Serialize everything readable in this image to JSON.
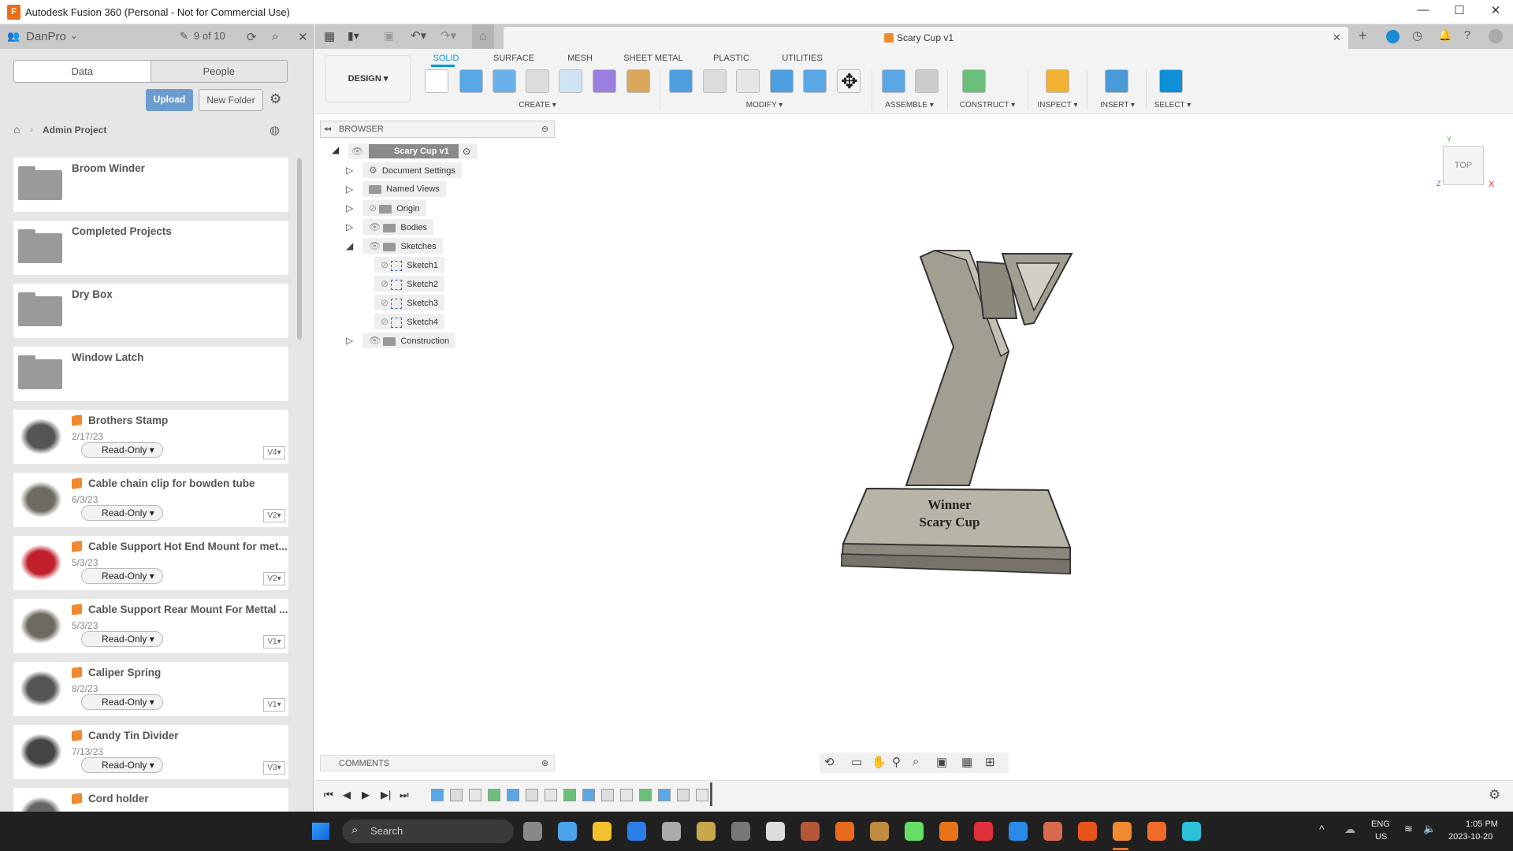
{
  "window": {
    "title": "Autodesk Fusion 360 (Personal - Not for Commercial Use)",
    "logo": "F"
  },
  "data_panel": {
    "team": "DanPro",
    "count": "9 of 10",
    "tabs": [
      "Data",
      "People"
    ],
    "upload": "Upload",
    "new_folder": "New Folder",
    "breadcrumb": "Admin Project",
    "folders": [
      "Broom Winder",
      "Completed Projects",
      "Dry Box",
      "Window Latch"
    ],
    "files": [
      {
        "name": "Brothers Stamp",
        "date": "2/17/23",
        "access": "Read-Only",
        "version": "V4",
        "thumb": "#555"
      },
      {
        "name": "Cable chain clip for bowden tube",
        "date": "6/3/23",
        "access": "Read-Only",
        "version": "V2",
        "thumb": "#6e6a60"
      },
      {
        "name": "Cable Support Hot End Mount for met...",
        "date": "5/3/23",
        "access": "Read-Only",
        "version": "V2",
        "thumb": "#c0202a"
      },
      {
        "name": "Cable Support Rear Mount For Mettal ...",
        "date": "5/3/23",
        "access": "Read-Only",
        "version": "V1",
        "thumb": "#6e6a60"
      },
      {
        "name": "Caliper Spring",
        "date": "8/2/23",
        "access": "Read-Only",
        "version": "V1",
        "thumb": "#555"
      },
      {
        "name": "Candy Tin Divider",
        "date": "7/13/23",
        "access": "Read-Only",
        "version": "V3",
        "thumb": "#444"
      },
      {
        "name": "Cord holder",
        "date": "",
        "access": "",
        "version": "",
        "thumb": "#666"
      }
    ]
  },
  "document": {
    "tab_title": "Scary Cup v1"
  },
  "toolbar": {
    "workspace": "DESIGN ▾",
    "tabs": [
      "SOLID",
      "SURFACE",
      "MESH",
      "SHEET METAL",
      "PLASTIC",
      "UTILITIES"
    ],
    "groups": [
      "CREATE ▾",
      "MODIFY ▾",
      "ASSEMBLE ▾",
      "CONSTRUCT ▾",
      "INSPECT ▾",
      "INSERT ▾",
      "SELECT ▾"
    ]
  },
  "browser": {
    "title": "BROWSER",
    "root": "Scary Cup v1",
    "items": [
      "Document Settings",
      "Named Views",
      "Origin",
      "Bodies",
      "Sketches",
      "Sketch1",
      "Sketch2",
      "Sketch3",
      "Sketch4",
      "Construction"
    ]
  },
  "model": {
    "line1": "Winner",
    "line2": "Scary Cup"
  },
  "viewcube": {
    "face": "TOP",
    "x": "X",
    "y": "Y",
    "z": "Z"
  },
  "comments": {
    "label": "COMMENTS"
  },
  "taskbar": {
    "search": "Search",
    "lang1": "ENG",
    "lang2": "US",
    "time": "1:05 PM",
    "date": "2023-10-20"
  },
  "colors": {
    "accent": "#0696d7",
    "upload": "#6c9ccf",
    "file_cube": "#f08a30"
  }
}
